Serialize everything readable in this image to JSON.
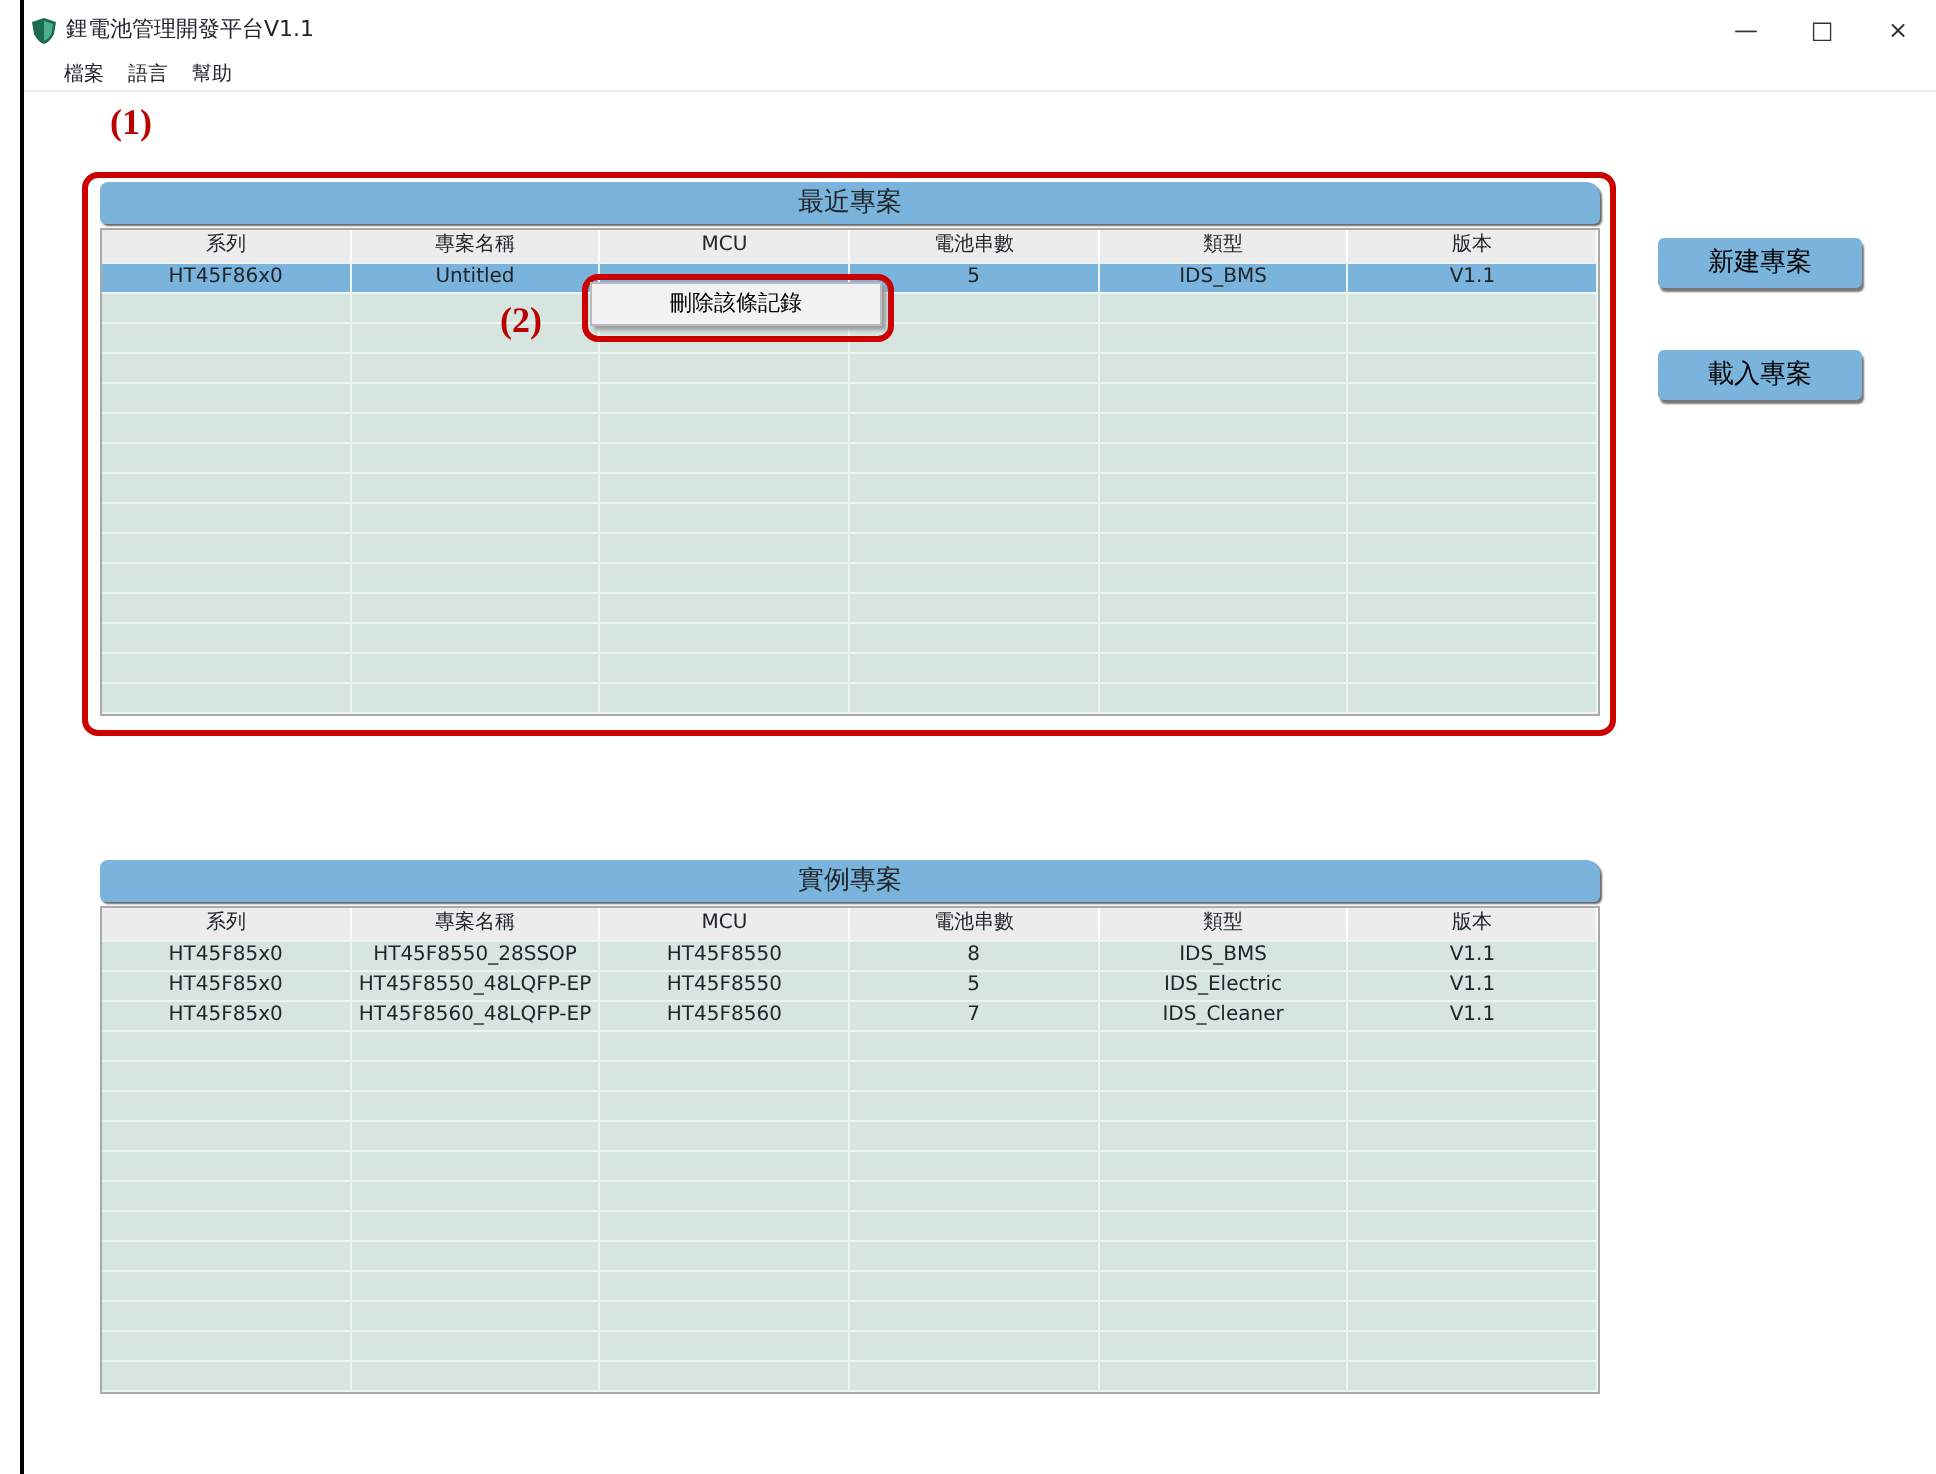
{
  "window": {
    "title": "鋰電池管理開發平台V1.1",
    "controls": [
      "—",
      "□",
      "×"
    ]
  },
  "menu": [
    "檔案",
    "語言",
    "幫助"
  ],
  "annotations": [
    {
      "label": "(1)"
    },
    {
      "label": "(2)"
    }
  ],
  "recent_projects": {
    "title": "最近專案",
    "highlighted": true,
    "columns": [
      "系列",
      "專案名稱",
      "MCU",
      "電池串數",
      "類型",
      "版本"
    ],
    "rows": [
      {
        "series": "HT45F86x0",
        "project_name": "Untitled",
        "cell_count": "5",
        "type": "IDS_BMS",
        "version": "V1.1",
        "selected": true
      }
    ],
    "context_menu": {
      "items": [
        "刪除該條記錄"
      ],
      "highlighted": true
    }
  },
  "buttons": [
    "新建專案",
    "載入專案"
  ],
  "example_projects": {
    "title": "實例專案",
    "columns": [
      "系列",
      "專案名稱",
      "MCU",
      "電池串數",
      "類型",
      "版本"
    ],
    "rows": [
      {
        "series": "HT45F85x0",
        "project_name": "HT45F8550_28SSOP",
        "mcu": "HT45F8550",
        "cell_count": "8",
        "type": "IDS_BMS",
        "version": "V1.1",
        "selected": false
      },
      {
        "series": "HT45F85x0",
        "project_name": "HT45F8550_48LQFP-EP",
        "mcu": "HT45F8550",
        "cell_count": "5",
        "type": "IDS_Electric",
        "version": "V1.1",
        "selected": false
      },
      {
        "series": "HT45F85x0",
        "project_name": "HT45F8560_48LQFP-EP",
        "mcu": "HT45F8560",
        "cell_count": "7",
        "type": "IDS_Cleaner",
        "version": "V1.1",
        "selected": false
      }
    ]
  }
}
